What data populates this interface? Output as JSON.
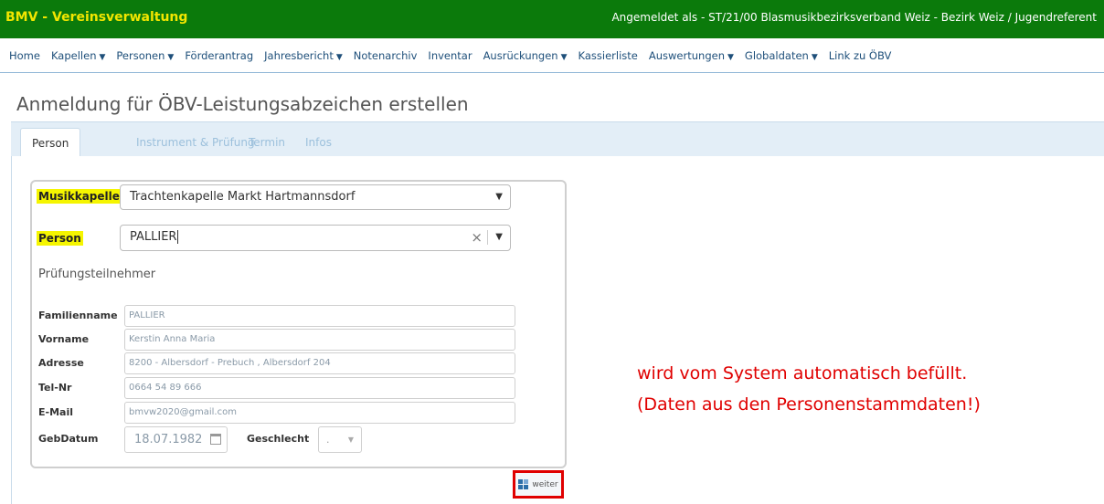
{
  "header": {
    "app_title": "BMV - Vereinsverwaltung",
    "login_info": "Angemeldet als - ST/21/00 Blasmusikbezirksverband Weiz - Bezirk Weiz / Jugendreferent"
  },
  "nav": {
    "items": [
      {
        "label": "Home",
        "dropdown": false
      },
      {
        "label": "Kapellen",
        "dropdown": true
      },
      {
        "label": "Personen",
        "dropdown": true
      },
      {
        "label": "Förderantrag",
        "dropdown": false
      },
      {
        "label": "Jahresbericht",
        "dropdown": true
      },
      {
        "label": "Notenarchiv",
        "dropdown": false
      },
      {
        "label": "Inventar",
        "dropdown": false
      },
      {
        "label": "Ausrückungen",
        "dropdown": true
      },
      {
        "label": "Kassierliste",
        "dropdown": false
      },
      {
        "label": "Auswertungen",
        "dropdown": true
      },
      {
        "label": "Globaldaten",
        "dropdown": true
      },
      {
        "label": "Link zu ÖBV",
        "dropdown": false
      }
    ],
    "caret": "▼"
  },
  "page": {
    "title": "Anmeldung für ÖBV-Leistungsabzeichen erstellen"
  },
  "tabs": [
    {
      "label": "Person",
      "active": true
    },
    {
      "label": "Instrument & Prüfung",
      "active": false
    },
    {
      "label": "Termin",
      "active": false
    },
    {
      "label": "Infos",
      "active": false
    }
  ],
  "form": {
    "musikkapelle_label": "Musikkapelle",
    "musikkapelle_value": "Trachtenkapelle Markt Hartmannsdorf",
    "person_label": "Person",
    "person_value": "PALLIER",
    "section_title": "Prüfungsteilnehmer",
    "fields": {
      "familienname": {
        "label": "Familienname",
        "value": "PALLIER"
      },
      "vorname": {
        "label": "Vorname",
        "value": "Kerstin Anna Maria"
      },
      "adresse": {
        "label": "Adresse",
        "value": "8200 - Albersdorf - Prebuch , Albersdorf 204"
      },
      "telnr": {
        "label": "Tel-Nr",
        "value": "0664 54 89 666"
      },
      "email": {
        "label": "E-Mail",
        "value": "bmvw2020@gmail.com"
      },
      "gebdatum": {
        "label": "GebDatum",
        "value": "18.07.1982"
      },
      "geschlecht": {
        "label": "Geschlecht",
        "value": "."
      }
    },
    "weiter_label": "weiter"
  },
  "annotation": {
    "line1": "wird vom System automatisch befüllt.",
    "line2": "(Daten aus den Personenstammdaten!)"
  },
  "colors": {
    "topbar": "#0b7a0b",
    "app_title": "#f2e600",
    "highlight": "#f5f500",
    "annotation": "#e00000",
    "nav_text": "#1e4f7a",
    "tab_strip": "#e3eef7"
  }
}
